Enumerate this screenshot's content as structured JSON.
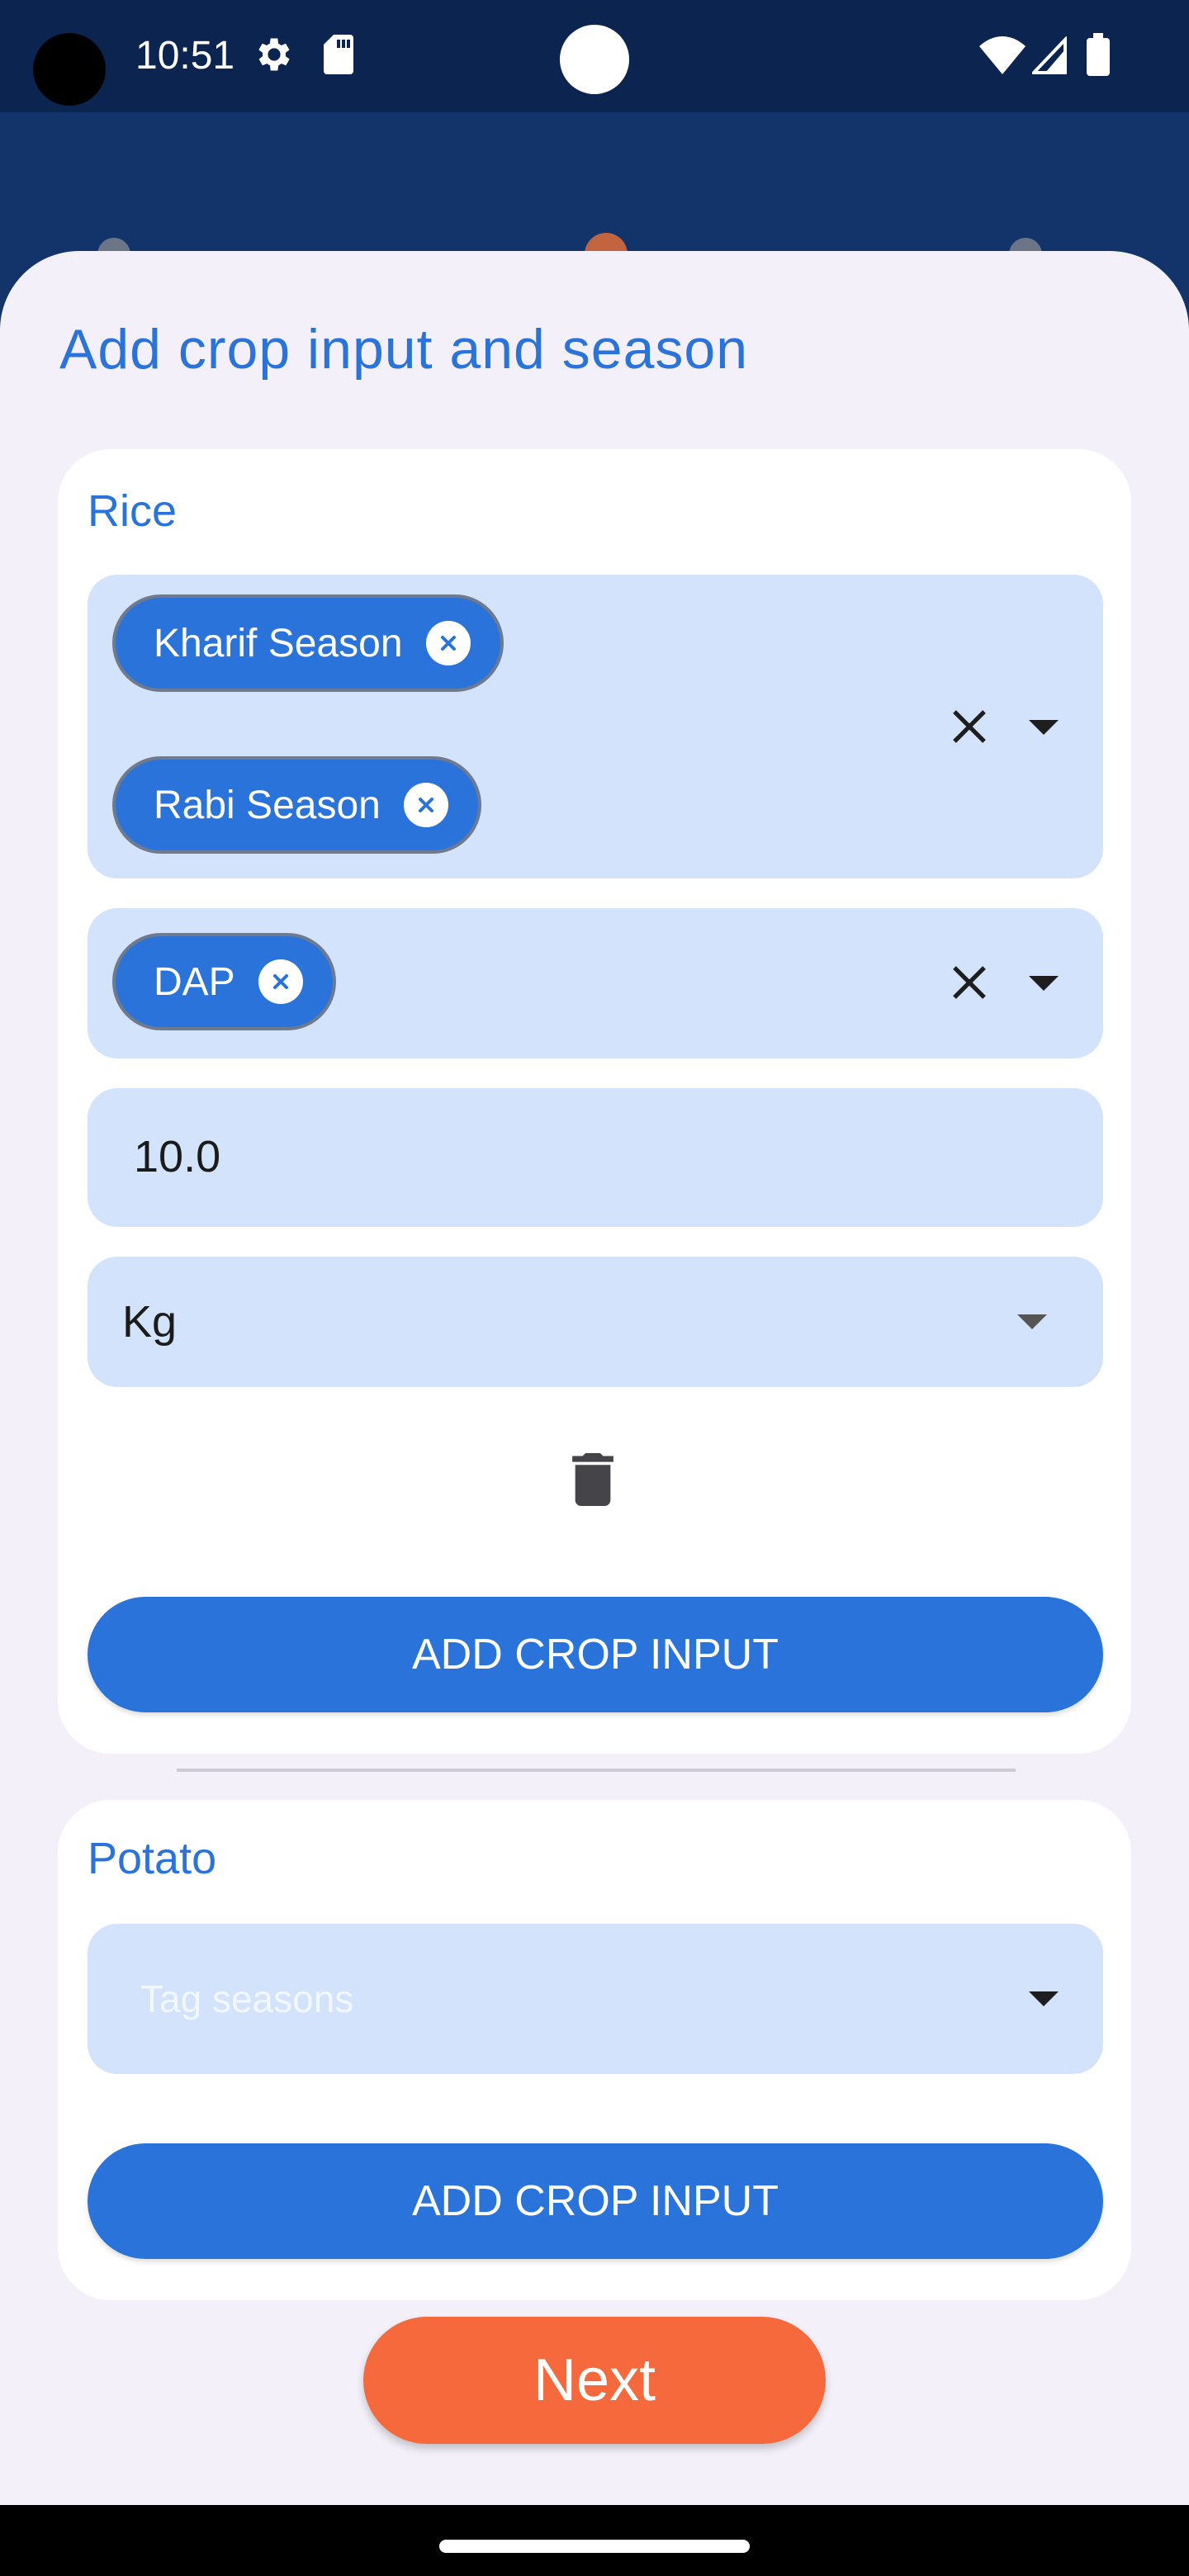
{
  "status_bar": {
    "time": "10:51",
    "icons": [
      "settings-gear-icon",
      "sd-card-icon",
      "wifi-icon",
      "signal-icon",
      "battery-icon"
    ]
  },
  "sheet": {
    "title": "Add crop input and season"
  },
  "crops": [
    {
      "name": "Rice",
      "seasons": [
        "Kharif Season",
        "Rabi Season"
      ],
      "input": "DAP",
      "quantity": "10.0",
      "unit": "Kg",
      "add_button": "ADD CROP INPUT"
    },
    {
      "name": "Potato",
      "season_placeholder": "Tag seasons",
      "add_button": "ADD CROP INPUT"
    }
  ],
  "next_button": "Next",
  "colors": {
    "accent": "#2a73da",
    "field_bg": "#d2e3fb",
    "next": "#f5693c",
    "sheet_bg": "#f4f0f9",
    "header_bg": "#12346b"
  }
}
